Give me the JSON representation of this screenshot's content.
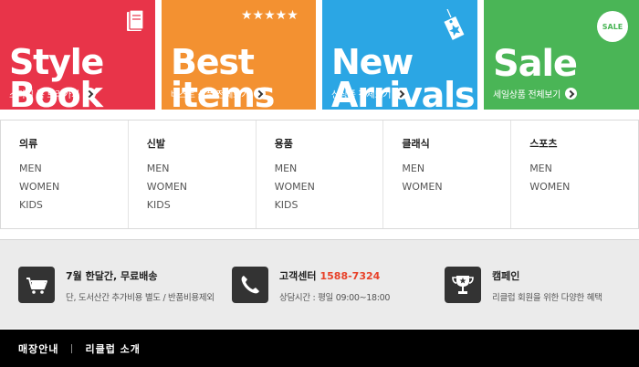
{
  "banners": [
    {
      "title": "Style\nBook",
      "sub": "스타일 북 보러가기",
      "color": "#e83449",
      "icon": "book-icon"
    },
    {
      "title": "Best\nitems",
      "sub": "베스트 상품 전체보기",
      "color": "#f39131",
      "icon": "stars-icon"
    },
    {
      "title": "New\nArrivals",
      "sub": "신상품 전체보기",
      "color": "#2ba6e4",
      "icon": "price-tag-icon"
    },
    {
      "title": "Sale",
      "sub": "세일상품 전체보기",
      "color": "#4ab556",
      "icon": "sale-badge-icon",
      "badge": "SALE"
    }
  ],
  "stars": "★★★★★",
  "categories": [
    {
      "title": "의류",
      "items": [
        "MEN",
        "WOMEN",
        "KIDS"
      ]
    },
    {
      "title": "신발",
      "items": [
        "MEN",
        "WOMEN",
        "KIDS"
      ]
    },
    {
      "title": "용품",
      "items": [
        "MEN",
        "WOMEN",
        "KIDS"
      ]
    },
    {
      "title": "클래식",
      "items": [
        "MEN",
        "WOMEN"
      ]
    },
    {
      "title": "스포츠",
      "items": [
        "MEN",
        "WOMEN"
      ]
    }
  ],
  "info": [
    {
      "title": "7월 한달간, 무료배송",
      "desc": "단, 도서산간 추가비용 별도 / 반품비용제외",
      "icon": "shopping-cart-icon"
    },
    {
      "title": "고객센터",
      "phone": "1588-7324",
      "desc": "상담시간 : 평일 09:00~18:00",
      "icon": "phone-icon"
    },
    {
      "title": "캠페인",
      "desc": "리클럽 회원을 위한 다양한 혜택",
      "icon": "trophy-icon"
    }
  ],
  "footer": {
    "link1": "매장안내",
    "link2": "리클럽 소개"
  }
}
